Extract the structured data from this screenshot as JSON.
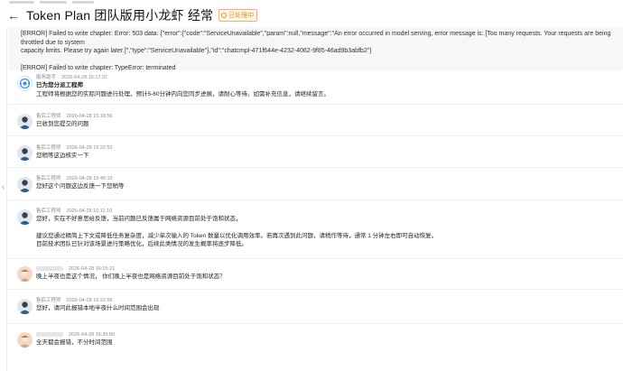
{
  "header": {
    "title": "Token Plan 团队版用小龙虾 经常",
    "status_badge": "已处理中"
  },
  "error_block": {
    "lines": [
      "[ERROR] Failed to write chapter: Error: 503 data: {\"error\":{\"code\":\"ServiceUnavailable\",\"param\":null,\"message\":\"An error occurred in model serving, error message is: [Too many requests. Your requests are being throttled due to system",
      "capacity limits. Please try again later.]\",\"type\":\"ServiceUnavailable\"},\"id\":\"chatcmpl-471f644e-4232-4062-9f85-46ad9b3abfb2\"}",
      "[ERROR] Failed to write chapter: TypeError: terminated"
    ]
  },
  "messages": [
    {
      "author": "服务助手",
      "time": "2026-04-28 15:17:37",
      "avatar": "bot-icon",
      "lines": [
        "已为您分派工程师",
        "工程师将根据您的实际问题进行处理，预计5-60分钟内向您同步进展，请耐心等待。如需补充信息，请继续留言。"
      ]
    },
    {
      "author": "售后工程师",
      "time": "2026-04-28 15:18:56",
      "avatar": "engineer-avatar",
      "lines": [
        "已收到您提交的问题"
      ]
    },
    {
      "author": "售后工程师",
      "time": "2026-04-28 15:22:52",
      "avatar": "engineer-avatar",
      "lines": [
        "您稍等这边核实一下"
      ]
    },
    {
      "author": "售后工程师",
      "time": "2026-04-28 15:46:10",
      "avatar": "engineer-avatar",
      "lines": [
        "您好这个问题这边反馈一下您稍等"
      ]
    },
    {
      "author": "售后工程师",
      "time": "2026-04-28 16:11:10",
      "avatar": "engineer-avatar",
      "lines": [
        "您好，实在不好意思给反馈，当前问题已反馈属于网络资源目前处于饱和状态，",
        "",
        "建议您通过精简上下文或降低任务复杂度，减少单次输入的 Token 数量以优化调用效率。若再次遇到此问题，请稍作等待，通常 1 分钟左右即可自动恢复。",
        "目前技术团队已针对该场景进行策略优化，后续此类情况的发生概率将逐步降低。"
      ]
    },
    {
      "author": "",
      "time": "2026-04-28 16:15:21",
      "avatar": "user-avatar",
      "lines": [
        "晚上半夜也是这个情况， 你们晚上半夜也是网络资源目前处于饱和状态？"
      ]
    },
    {
      "author": "售后工程师",
      "time": "2026-04-28 16:22:56",
      "avatar": "engineer-avatar",
      "lines": [
        "您好，请问此报错本地半夜什么时间范围会出现"
      ]
    },
    {
      "author": "",
      "time": "2026-04-28 16:30:50",
      "avatar": "user-avatar",
      "lines": [
        "全天都会报错，不分时间范围"
      ]
    }
  ]
}
